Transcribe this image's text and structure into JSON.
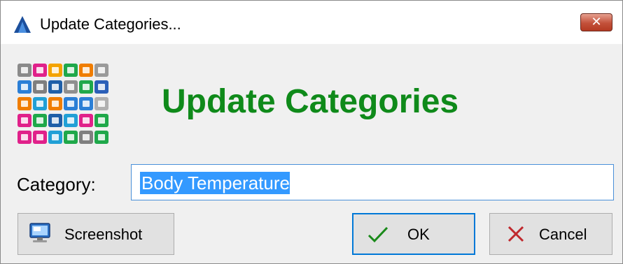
{
  "window": {
    "title": "Update Categories...",
    "close_glyph": "✕",
    "icons": {
      "app": "app-logo-icon",
      "close": "close-icon"
    }
  },
  "header": {
    "heading": "Update Categories",
    "heading_color": "#0f8a1a",
    "logo_icon": "category-grid-logo-icon",
    "logo_tile_colors": [
      "#8a8a8a",
      "#e0218a",
      "#f4a300",
      "#1fa84a",
      "#f07d00",
      "#9a9a9a",
      "#2b7fd6",
      "#7f7f7f",
      "#1f5fa8",
      "#8f8f8f",
      "#1fa84a",
      "#2b5fb8",
      "#f07d00",
      "#21a0d6",
      "#f07d00",
      "#2b7fd6",
      "#2b7fd6",
      "#b0b0b0",
      "#e0218a",
      "#1fa84a",
      "#1f5fa8",
      "#21a0d6",
      "#e0218a",
      "#1fa84a",
      "#e0218a",
      "#e0218a",
      "#21a0d6",
      "#1fa84a",
      "#7f7f7f",
      "#1fa84a"
    ]
  },
  "form": {
    "category_label": "Category:",
    "category_value": "Body Temperature"
  },
  "buttons": {
    "screenshot_label": "Screenshot",
    "ok_label": "OK",
    "cancel_label": "Cancel",
    "icons": {
      "screenshot": "monitor-icon",
      "ok": "checkmark-icon",
      "cancel": "x-mark-icon"
    }
  },
  "colors": {
    "selection": "#3399ff",
    "focus_border": "#0078d7",
    "check": "#1a8a1a",
    "cancel_x": "#c0282d"
  }
}
